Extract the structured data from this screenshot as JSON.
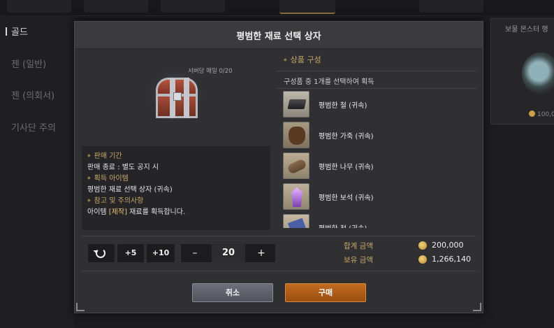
{
  "background": {
    "sidebar": {
      "items": [
        {
          "label": "골드"
        },
        {
          "label": "젠 (일반)"
        },
        {
          "label": "젠 (의회서)"
        },
        {
          "label": "기사단 주의"
        }
      ]
    },
    "right_card": {
      "title": "보물 몬스터 행",
      "price": "100,0"
    }
  },
  "modal": {
    "title": "평범한 재료 선택 상자",
    "limit_text": "서버당 매일 0/20",
    "info": [
      {
        "heading": "판매 기간",
        "value": "판매 종료 : 별도 공지 시"
      },
      {
        "heading": "획득 아이템",
        "value": "평범한 재료 선택 상자 (귀속)"
      },
      {
        "heading": "참고 및 주의사항",
        "value_prefix": "아이템 ",
        "value_highlight": "[제작]",
        "value_suffix": " 재료를 획득합니다."
      }
    ],
    "composition_title": "상품 구성",
    "composition_subtitle": "구성품 중 1개를 선택하여 획득",
    "items": [
      {
        "name": "평범한 철 (귀속)",
        "icon": "iron-ingot-icon"
      },
      {
        "name": "평범한 가죽 (귀속)",
        "icon": "leather-hide-icon"
      },
      {
        "name": "평범한 나무 (귀속)",
        "icon": "wood-log-icon"
      },
      {
        "name": "평범한 보석 (귀속)",
        "icon": "crystal-gem-icon"
      },
      {
        "name": "평범한 천 (귀속)",
        "icon": "cloth-icon"
      }
    ],
    "quantity": {
      "plus5_label": "+5",
      "plus10_label": "+10",
      "minus_label": "–",
      "plus_label": "+",
      "value": "20"
    },
    "total_label": "합계 금액",
    "total_value": "200,000",
    "owned_label": "보유 금액",
    "owned_value": "1,266,140",
    "cancel_label": "취소",
    "buy_label": "구매"
  },
  "colors": {
    "accent_gold": "#c9a86a",
    "buy_orange": "#c06b1f",
    "panel_bg": "#303033"
  }
}
